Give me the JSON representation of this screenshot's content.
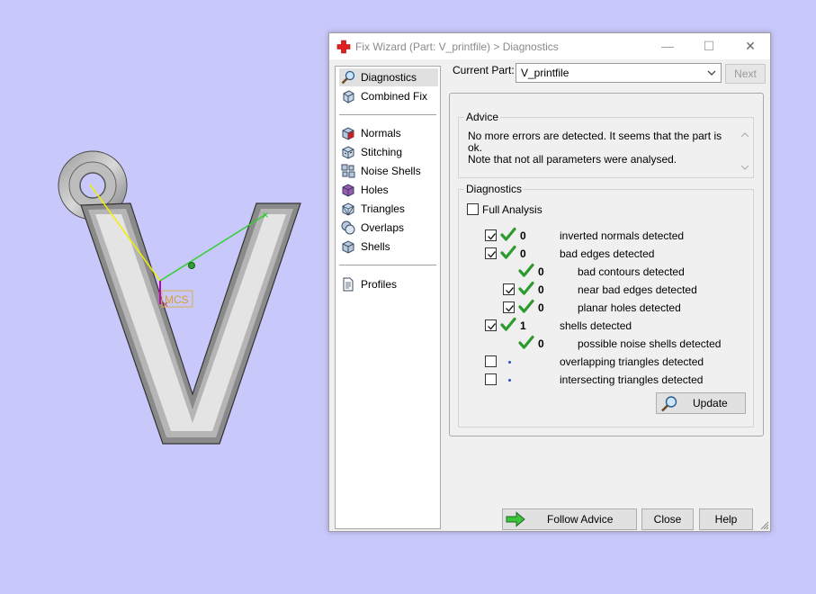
{
  "viewport": {
    "mcs_label": "MCS"
  },
  "window": {
    "title": "Fix Wizard (Part: V_printfile) > Diagnostics",
    "title_icon": "red-cross-icon",
    "minimize_symbol": "—",
    "maximize_symbol": "☐",
    "close_symbol": "✕"
  },
  "nav": {
    "items": [
      {
        "label": "Diagnostics",
        "icon": "magnifier-icon"
      },
      {
        "label": "Combined Fix",
        "icon": "cube-icon"
      },
      {
        "label": "Normals",
        "icon": "normals-cube-icon"
      },
      {
        "label": "Stitching",
        "icon": "stitching-cube-icon"
      },
      {
        "label": "Noise Shells",
        "icon": "noise-shells-icon"
      },
      {
        "label": "Holes",
        "icon": "holes-cube-icon"
      },
      {
        "label": "Triangles",
        "icon": "triangles-cube-icon"
      },
      {
        "label": "Overlaps",
        "icon": "overlaps-icon"
      },
      {
        "label": "Shells",
        "icon": "shells-cube-icon"
      },
      {
        "label": "Profiles",
        "icon": "document-icon"
      }
    ]
  },
  "current_part": {
    "label": "Current Part:",
    "value": "V_printfile",
    "next_label": "Next"
  },
  "advice": {
    "group_label": "Advice",
    "line1": "No more errors are detected. It seems that the part is ok.",
    "line2": "Note that not all parameters were analysed."
  },
  "diagnostics": {
    "group_label": "Diagnostics",
    "full_analysis_label": "Full Analysis",
    "rows": [
      {
        "checked": true,
        "status": "ok",
        "count": "0",
        "label": "inverted normals detected"
      },
      {
        "checked": true,
        "status": "ok",
        "count": "0",
        "label": "bad edges detected"
      },
      {
        "checked": null,
        "status": "ok",
        "count": "0",
        "label": "bad contours detected"
      },
      {
        "checked": true,
        "status": "ok",
        "count": "0",
        "label": "near bad edges detected"
      },
      {
        "checked": true,
        "status": "ok",
        "count": "0",
        "label": "planar holes detected"
      },
      {
        "checked": true,
        "status": "ok",
        "count": "1",
        "label": "shells detected"
      },
      {
        "checked": null,
        "status": "ok",
        "count": "0",
        "label": "possible noise shells detected"
      },
      {
        "checked": false,
        "status": "pending",
        "count": "",
        "label": "overlapping triangles detected"
      },
      {
        "checked": false,
        "status": "pending",
        "count": "",
        "label": "intersecting triangles detected"
      }
    ],
    "update_label": "Update"
  },
  "footer": {
    "follow_advice_label": "Follow Advice",
    "close_label": "Close",
    "help_label": "Help"
  },
  "colors": {
    "background": "#c8c8fb",
    "check_green": "#2e9a2e",
    "pending_dot": "#2050d0"
  }
}
